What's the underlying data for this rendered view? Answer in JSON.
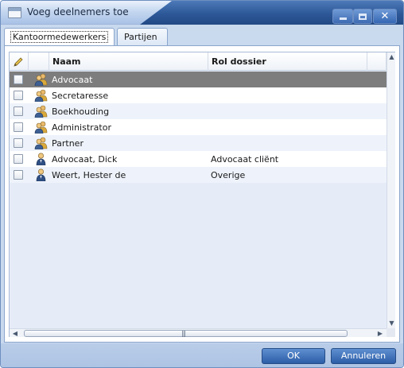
{
  "window": {
    "title": "Voeg deelnemers toe",
    "title_icon": "window-icon",
    "buttons": [
      "minimize-icon",
      "maximize-icon",
      "close-icon"
    ]
  },
  "tabs": [
    {
      "label": "Kantoormedewerkers",
      "active": true
    },
    {
      "label": "Partijen",
      "active": false
    }
  ],
  "grid": {
    "columns": {
      "edit_icon": "pencil-icon",
      "naam": "Naam",
      "rol": "Rol dossier"
    },
    "rows": [
      {
        "naam": "Advocaat",
        "rol": "",
        "icon": "group-icon",
        "selected": true
      },
      {
        "naam": "Secretaresse",
        "rol": "",
        "icon": "group-icon",
        "selected": false
      },
      {
        "naam": "Boekhouding",
        "rol": "",
        "icon": "group-icon",
        "selected": false
      },
      {
        "naam": "Administrator",
        "rol": "",
        "icon": "group-icon",
        "selected": false
      },
      {
        "naam": "Partner",
        "rol": "",
        "icon": "group-icon",
        "selected": false
      },
      {
        "naam": "Advocaat, Dick",
        "rol": "Advocaat cliënt",
        "icon": "person-icon",
        "selected": false
      },
      {
        "naam": "Weert, Hester de",
        "rol": "Overige",
        "icon": "person-icon",
        "selected": false
      }
    ]
  },
  "footer": {
    "ok": "OK",
    "cancel": "Annuleren"
  },
  "colors": {
    "selected_row": "#7d7d7d",
    "button": "#3a6bb3",
    "titlebar_dark": "#204d91"
  }
}
